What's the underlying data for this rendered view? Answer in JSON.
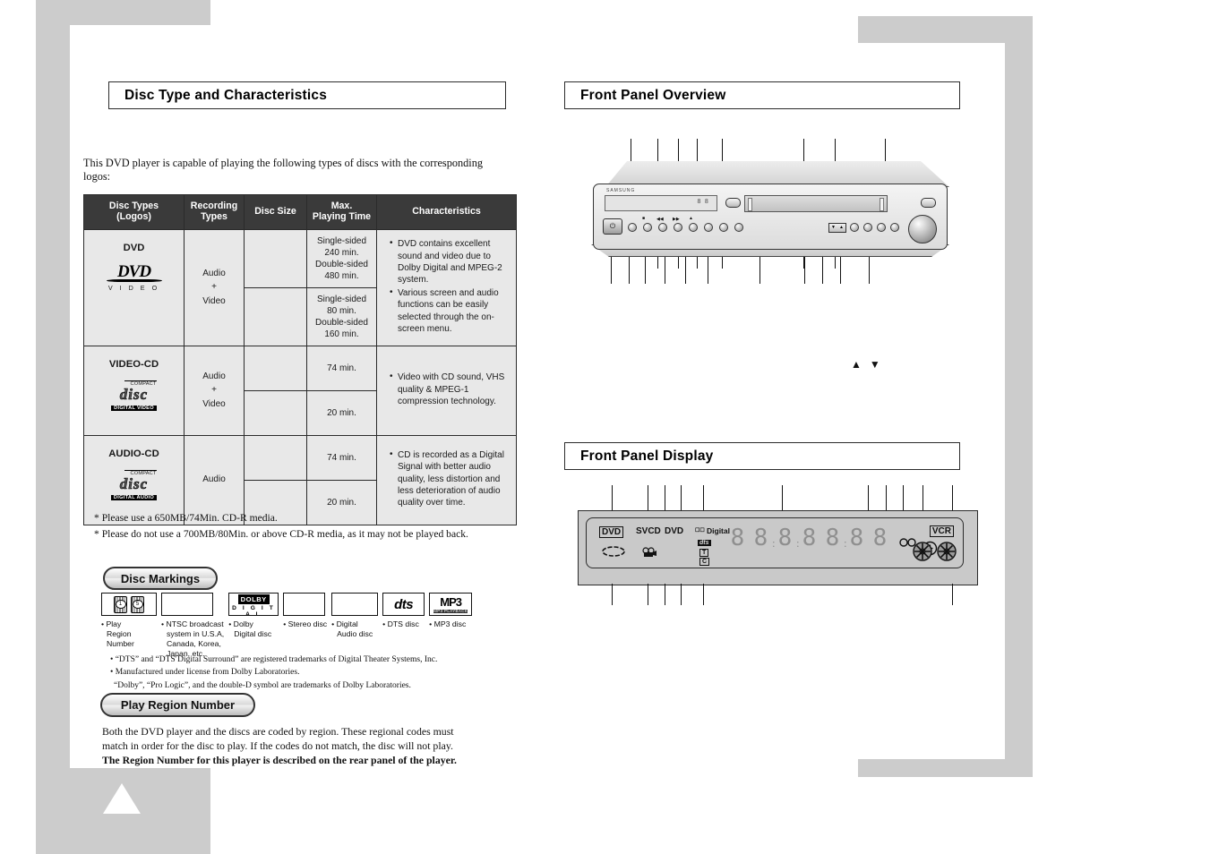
{
  "left_page": {
    "section_title": "Disc Type and Characteristics",
    "intro": "This DVD player is capable of playing the following types of discs with the corresponding logos:",
    "table": {
      "headers": [
        "Disc Types\n(Logos)",
        "Recording\nTypes",
        "Disc Size",
        "Max.\nPlaying Time",
        "Characteristics"
      ],
      "headers_flat": {
        "disc_types": "Disc Types",
        "disc_types_sub": "(Logos)",
        "recording": "Recording",
        "recording_sub": "Types",
        "disc_size": "Disc Size",
        "max_playing": "Max.",
        "max_playing_sub": "Playing Time",
        "characteristics": "Characteristics"
      },
      "rows": [
        {
          "type": "DVD",
          "logo": "dvd-video-logo",
          "logo_text_main": "DVD",
          "logo_text_sub": "V I D E O",
          "recording": "Audio\n+\nVideo",
          "recording_l1": "Audio",
          "recording_l2": "+",
          "recording_l3": "Video",
          "disc_size": "",
          "times": [
            "Single-sided\n240 min.\nDouble-sided\n480 min.",
            "Single-sided\n80 min.\nDouble-sided\n160 min."
          ],
          "time_a_l1": "Single-sided",
          "time_a_l2": "240 min.",
          "time_a_l3": "Double-sided",
          "time_a_l4": "480 min.",
          "time_b_l1": "Single-sided",
          "time_b_l2": "80 min.",
          "time_b_l3": "Double-sided",
          "time_b_l4": "160 min.",
          "characteristics": [
            "DVD contains excellent sound and video due to Dolby Digital and MPEG-2 system.",
            "Various screen and audio functions can be easily selected through the on-screen menu."
          ]
        },
        {
          "type": "VIDEO-CD",
          "logo": "compact-disc-digital-video-logo",
          "logo_top": "COMPACT",
          "logo_mid": "disc",
          "logo_bot": "DIGITAL VIDEO",
          "recording_l1": "Audio",
          "recording_l2": "+",
          "recording_l3": "Video",
          "disc_size": "",
          "time_a": "74 min.",
          "time_b": "20 min.",
          "characteristics": [
            "Video with CD sound, VHS quality & MPEG-1 compression technology."
          ]
        },
        {
          "type": "AUDIO-CD",
          "logo": "compact-disc-digital-audio-logo",
          "logo_top": "COMPACT",
          "logo_mid": "disc",
          "logo_bot": "DIGITAL AUDIO",
          "recording_l1": "Audio",
          "recording_l2": "",
          "recording_l3": "",
          "disc_size": "",
          "time_a": "74 min.",
          "time_b": "20 min.",
          "characteristics": [
            "CD is recorded as a Digital Signal with better audio quality, less distortion and less deterioration of audio quality over time."
          ]
        }
      ]
    },
    "footnotes": [
      "* Please use a 650MB/74Min. CD-R media.",
      "* Please do not use a 700MB/80Min. or above CD-R media, as it may not be played back."
    ],
    "disc_markings_title": "Disc Markings",
    "markings": [
      {
        "logo": "play-region-number-logo",
        "badge_1": "1",
        "badge_2": "5",
        "caption": "• Play\n  Region\n  Number",
        "caption_l1": "• Play",
        "caption_l2": "Region",
        "caption_l3": "Number"
      },
      {
        "logo": "ntsc-logo",
        "caption_l1": "• NTSC broadcast",
        "caption_l2": "system in U.S.A,",
        "caption_l3": "Canada, Korea,",
        "caption_l4": "Japan, etc."
      },
      {
        "logo": "dolby-digital-logo",
        "logo_top": "DOLBY",
        "logo_bottom": "D I G I T A L",
        "caption_l1": "• Dolby",
        "caption_l2": "Digital disc"
      },
      {
        "logo": "stereo-disc-logo",
        "caption_l1": "• Stereo disc"
      },
      {
        "logo": "digital-audio-disc-logo",
        "caption_l1": "• Digital",
        "caption_l2": "Audio disc"
      },
      {
        "logo": "dts-logo",
        "logo_text": "dts",
        "caption_l1": "• DTS disc"
      },
      {
        "logo": "mp3-logo",
        "logo_text": "MP3",
        "logo_sub": "MP3 PLAYBACK",
        "caption_l1": "• MP3 disc"
      }
    ],
    "trademark_notes": [
      "• “DTS” and “DTS Digital Surround” are registered trademarks of Digital Theater Systems, Inc.",
      "• Manufactured under license from Dolby Laboratories.",
      "“Dolby”, “Pro Logic”, and the double-D symbol are trademarks of Dolby Laboratories."
    ],
    "play_region_title": "Play Region Number",
    "play_region_body_1": "Both the DVD player and the discs are coded by region. These regional codes must",
    "play_region_body_2": "match in order for the disc to play. If the codes do not match, the disc will not play.",
    "play_region_body_bold": "The Region Number for this player is described on the rear panel of the player."
  },
  "right_page": {
    "front_panel_overview_title": "Front Panel Overview",
    "front_panel_display_title": "Front Panel Display",
    "unit": {
      "brand_mark": "SAMSUNG",
      "power_icon": "power-icon",
      "eject_icon": "eject-icon",
      "jog_icon": "jog-dial",
      "updown_glyphs": "▲ ▼"
    },
    "display_panel": {
      "indicators": [
        {
          "name": "dvd-indicator",
          "label": "DVD",
          "boxed": true
        },
        {
          "name": "svcd-indicator",
          "label": "SVCD",
          "boxed": false
        },
        {
          "name": "dvd2-indicator",
          "label": "DVD",
          "boxed": false
        },
        {
          "name": "dolby-digital-indicator",
          "label": "Digital",
          "prefix": "☐☐",
          "boxed": false
        },
        {
          "name": "dts-indicator",
          "label": "dts",
          "boxed": false
        },
        {
          "name": "title-indicator",
          "label": "T",
          "boxed": true
        },
        {
          "name": "chapter-indicator",
          "label": "C",
          "boxed": true
        },
        {
          "name": "vcr-indicator",
          "label": "VCR",
          "boxed": true
        }
      ],
      "disc-icon": "disc-ellipse-icon",
      "camera-icon": "camcorder-icon",
      "loop-icon": "repeat-loop-icon",
      "clock-icon": "clock-icon",
      "reel-icon": "tape-reel-icon",
      "segment_count": 7,
      "segment_sample": "8"
    }
  },
  "colors": {
    "page_gray": "#cccccc",
    "table_header": "#3a3a3a",
    "table_cell": "#e8e8e8",
    "ink": "#111111",
    "unit_body": "#dcdcdc",
    "display_bg": "#c9c9c9"
  }
}
